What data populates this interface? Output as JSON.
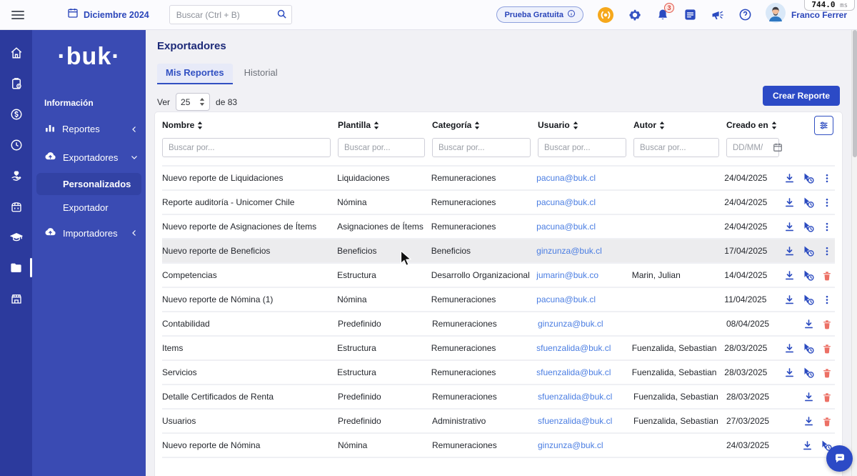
{
  "topbar": {
    "date_label": "Diciembre 2024",
    "search_placeholder": "Buscar (Ctrl + B)",
    "trial_badge": "Prueba Gratuita",
    "notification_count": "3",
    "user_name": "Franco Ferrer",
    "perf": {
      "value": "744.0",
      "unit": "ms"
    }
  },
  "sidebar": {
    "logo": "·buk·",
    "section": "Información",
    "reportes": "Reportes",
    "exportadores": "Exportadores",
    "personalizados": "Personalizados",
    "exportador": "Exportador",
    "importadores": "Importadores"
  },
  "main": {
    "title": "Exportadores",
    "tabs": [
      {
        "label": "Mis Reportes"
      },
      {
        "label": "Historial"
      }
    ],
    "pagination": {
      "ver_label": "Ver",
      "page_size": "25",
      "of_label": "de 83"
    },
    "create_button": "Crear Reporte",
    "table": {
      "columns": [
        "Nombre",
        "Plantilla",
        "Categoría",
        "Usuario",
        "Autor",
        "Creado en"
      ],
      "filter_placeholder": "Buscar por...",
      "date_placeholder": "DD/MM/Y",
      "rows": [
        {
          "nombre": "Nuevo reporte de Liquidaciones",
          "plantilla": "Liquidaciones",
          "categoria": "Remuneraciones",
          "usuario": "pacuna@buk.cl",
          "autor": "",
          "creado": "24/04/2025",
          "actions": [
            "download",
            "run",
            "menu"
          ],
          "hover": false
        },
        {
          "nombre": "Reporte auditoría - Unicomer Chile",
          "plantilla": "Nómina",
          "categoria": "Remuneraciones",
          "usuario": "pacuna@buk.cl",
          "autor": "",
          "creado": "24/04/2025",
          "actions": [
            "download",
            "run",
            "menu"
          ],
          "hover": false
        },
        {
          "nombre": "Nuevo reporte de Asignaciones de Ítems",
          "plantilla": "Asignaciones de Ítems",
          "categoria": "Remuneraciones",
          "usuario": "pacuna@buk.cl",
          "autor": "",
          "creado": "24/04/2025",
          "actions": [
            "download",
            "run",
            "menu"
          ],
          "hover": false
        },
        {
          "nombre": "Nuevo reporte de Beneficios",
          "plantilla": "Beneficios",
          "categoria": "Beneficios",
          "usuario": "ginzunza@buk.cl",
          "autor": "",
          "creado": "17/04/2025",
          "actions": [
            "download",
            "run",
            "menu"
          ],
          "hover": true
        },
        {
          "nombre": "Competencias",
          "plantilla": "Estructura",
          "categoria": "Desarrollo Organizacional",
          "usuario": "jumarin@buk.co",
          "autor": "Marin, Julian",
          "creado": "14/04/2025",
          "actions": [
            "download",
            "run",
            "delete"
          ],
          "hover": false
        },
        {
          "nombre": "Nuevo reporte de Nómina (1)",
          "plantilla": "Nómina",
          "categoria": "Remuneraciones",
          "usuario": "pacuna@buk.cl",
          "autor": "",
          "creado": "11/04/2025",
          "actions": [
            "download",
            "run",
            "menu"
          ],
          "hover": false
        },
        {
          "nombre": "Contabilidad",
          "plantilla": "Predefinido",
          "categoria": "Remuneraciones",
          "usuario": "ginzunza@buk.cl",
          "autor": "",
          "creado": "08/04/2025",
          "actions": [
            "download",
            "delete"
          ],
          "hover": false
        },
        {
          "nombre": "Items",
          "plantilla": "Estructura",
          "categoria": "Remuneraciones",
          "usuario": "sfuenzalida@buk.cl",
          "autor": "Fuenzalida, Sebastian",
          "creado": "28/03/2025",
          "actions": [
            "download",
            "run",
            "delete"
          ],
          "hover": false
        },
        {
          "nombre": "Servicios",
          "plantilla": "Estructura",
          "categoria": "Remuneraciones",
          "usuario": "sfuenzalida@buk.cl",
          "autor": "Fuenzalida, Sebastian",
          "creado": "28/03/2025",
          "actions": [
            "download",
            "run",
            "delete"
          ],
          "hover": false
        },
        {
          "nombre": "Detalle Certificados de Renta",
          "plantilla": "Predefinido",
          "categoria": "Remuneraciones",
          "usuario": "sfuenzalida@buk.cl",
          "autor": "Fuenzalida, Sebastian",
          "creado": "28/03/2025",
          "actions": [
            "download",
            "delete"
          ],
          "hover": false
        },
        {
          "nombre": "Usuarios",
          "plantilla": "Predefinido",
          "categoria": "Administrativo",
          "usuario": "sfuenzalida@buk.cl",
          "autor": "Fuenzalida, Sebastian",
          "creado": "27/03/2025",
          "actions": [
            "download",
            "delete"
          ],
          "hover": false
        },
        {
          "nombre": "Nuevo reporte de Nómina",
          "plantilla": "Nómina",
          "categoria": "Remuneraciones",
          "usuario": "ginzunza@buk.cl",
          "autor": "",
          "creado": "24/03/2025",
          "actions": [
            "download",
            "run"
          ],
          "hover": false
        }
      ]
    }
  }
}
